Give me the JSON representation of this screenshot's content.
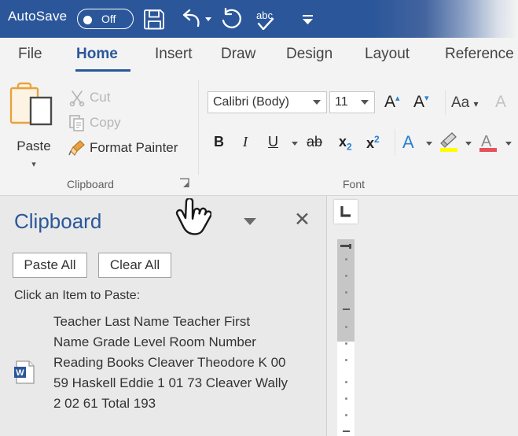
{
  "titlebar": {
    "autosave_label": "AutoSave",
    "autosave_state": "Off",
    "quick_access": [
      {
        "name": "save-icon",
        "label": "Save"
      },
      {
        "name": "undo-icon",
        "label": "Undo"
      },
      {
        "name": "undo-dropdown-icon",
        "label": "Undo options"
      },
      {
        "name": "redo-icon",
        "label": "Redo"
      },
      {
        "name": "spelling-check-icon",
        "label": "Spelling & Grammar"
      },
      {
        "name": "customize-quick-access-toolbar-icon",
        "label": "Customize Quick Access Toolbar"
      }
    ]
  },
  "tabs": [
    {
      "label": "File",
      "active": false
    },
    {
      "label": "Home",
      "active": true
    },
    {
      "label": "Insert",
      "active": false
    },
    {
      "label": "Draw",
      "active": false
    },
    {
      "label": "Design",
      "active": false
    },
    {
      "label": "Layout",
      "active": false
    },
    {
      "label": "Reference",
      "active": false
    }
  ],
  "ribbon": {
    "clipboard": {
      "group_label": "Clipboard",
      "paste_label": "Paste",
      "cut_label": "Cut",
      "copy_label": "Copy",
      "format_painter_label": "Format Painter",
      "dialog_launcher_name": "clipboard-dialog-launcher"
    },
    "font": {
      "group_label": "Font",
      "font_name_value": "Calibri (Body)",
      "font_size_value": "11",
      "grow_font_label": "A",
      "shrink_font_label": "A",
      "change_case_label": "Aa",
      "clear_formatting_label": "A",
      "bold_label": "B",
      "italic_label": "I",
      "underline_label": "U",
      "strikethrough_label": "ab",
      "subscript_label": "x",
      "subscript_sub": "2",
      "superscript_label": "x",
      "superscript_sup": "2",
      "text_effects_label": "A",
      "highlight_label": "",
      "font_color_label": "A"
    }
  },
  "clipboard_pane": {
    "title": "Clipboard",
    "paste_all_label": "Paste All",
    "clear_all_label": "Clear All",
    "hint": "Click an Item to Paste:",
    "items": [
      {
        "icon": "word-document-icon",
        "text": "Teacher Last Name Teacher First Name Grade Level Room Number Reading Books Cleaver Theodore K 00 59 Haskell Eddie 1 01 73 Cleaver Wally 2 02 61 Total 193"
      }
    ],
    "collapse_icon": "chevron-down-icon",
    "close_icon": "close-icon"
  },
  "ruler": {
    "tab_stop_selector_icon": "left-tab-stop-icon"
  },
  "cursor": {
    "icon": "hand-pointer-cursor"
  },
  "colors": {
    "title_bar": "#2b579a",
    "accent": "#2b579a",
    "ribbon_bg": "#f3f3f3",
    "pane_bg": "#e9e9e9",
    "highlight_yellow": "#ffff00",
    "font_color_red": "#e8505b"
  }
}
